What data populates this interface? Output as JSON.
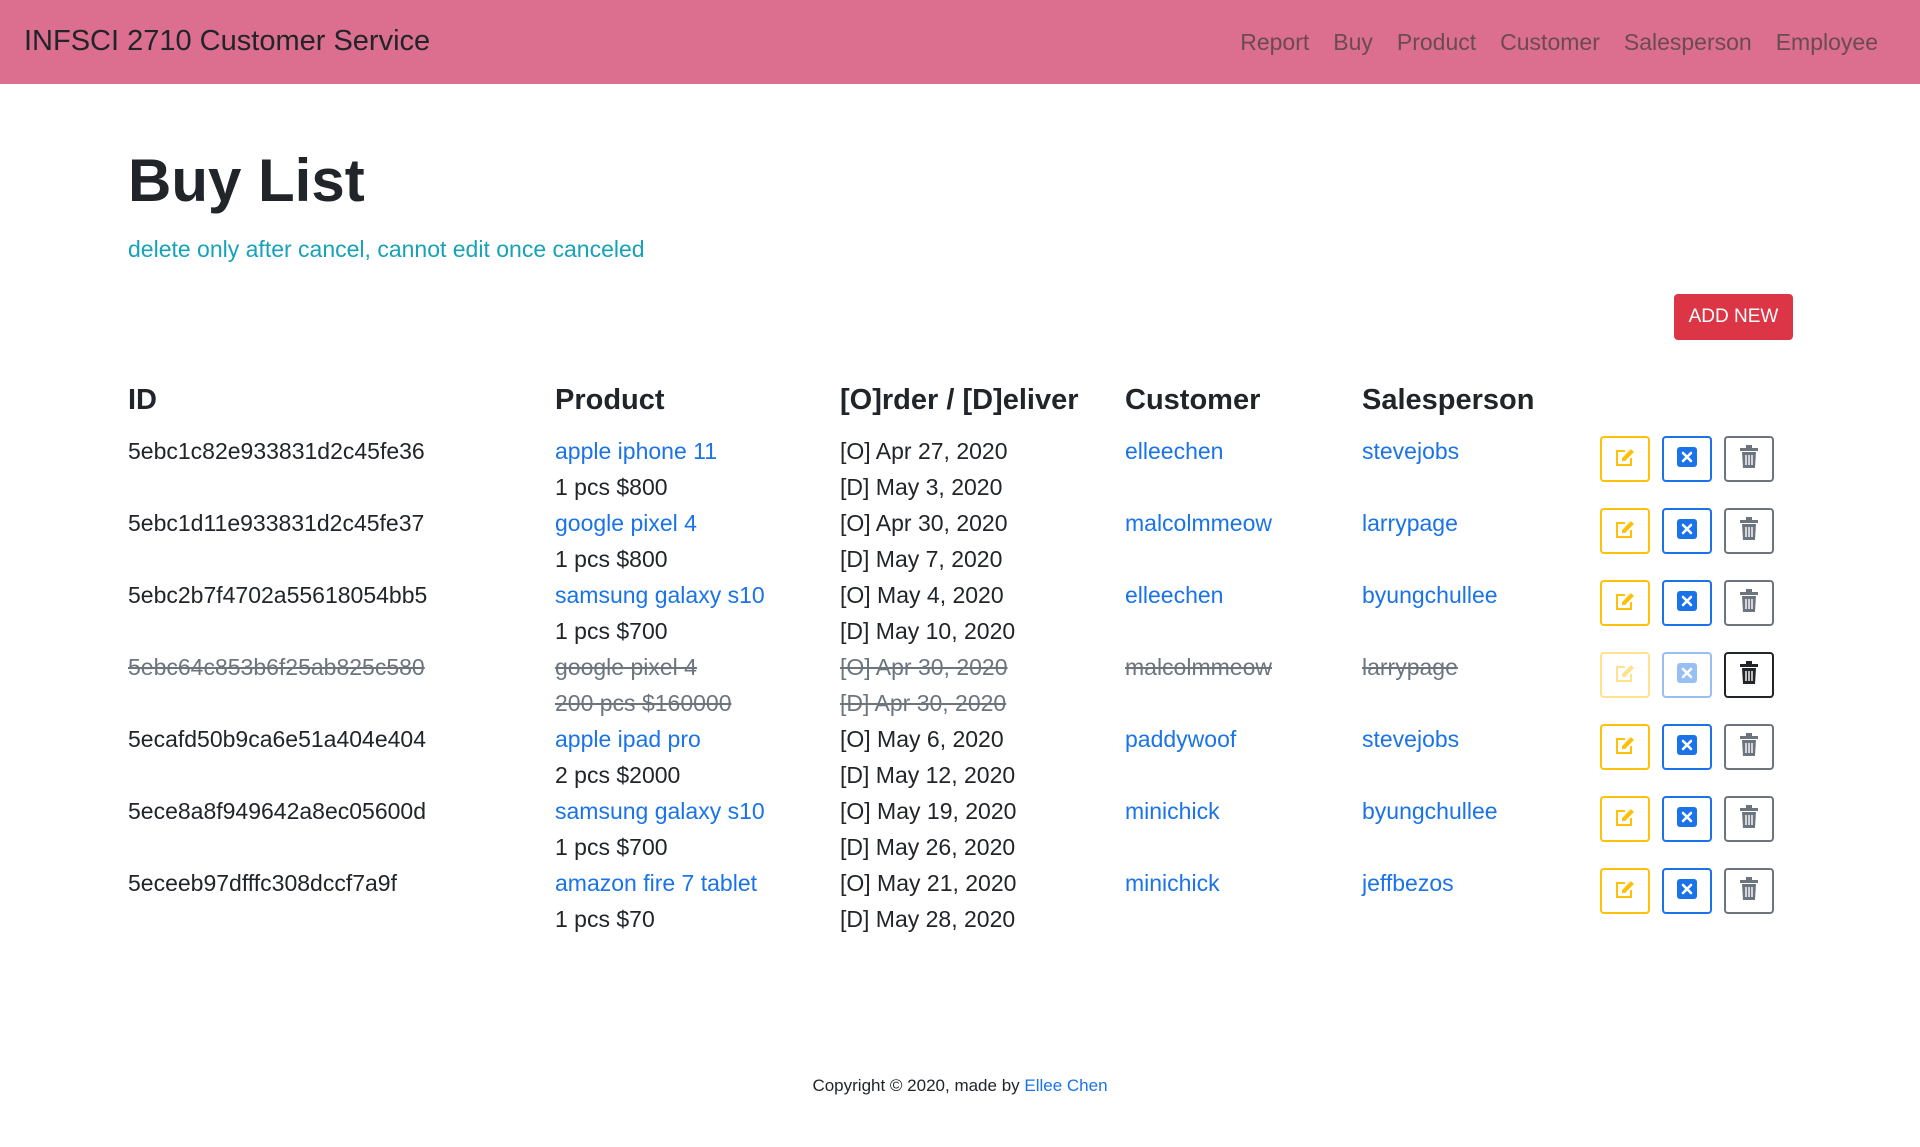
{
  "navbar": {
    "brand": "INFSCI 2710 Customer Service",
    "links": [
      "Report",
      "Buy",
      "Product",
      "Customer",
      "Salesperson",
      "Employee"
    ]
  },
  "page": {
    "title": "Buy List",
    "note": "delete only after cancel, cannot edit once canceled",
    "add_label": "ADD NEW"
  },
  "table": {
    "headers": [
      "ID",
      "Product",
      "[O]rder / [D]eliver",
      "Customer",
      "Salesperson"
    ],
    "rows": [
      {
        "id": "5ebc1c82e933831d2c45fe36",
        "product": "apple iphone 11",
        "qty_price": "1 pcs $800",
        "order": "[O] Apr 27, 2020",
        "deliver": "[D] May 3, 2020",
        "customer": "elleechen",
        "salesperson": "stevejobs",
        "canceled": false
      },
      {
        "id": "5ebc1d11e933831d2c45fe37",
        "product": "google pixel 4",
        "qty_price": "1 pcs $800",
        "order": "[O] Apr 30, 2020",
        "deliver": "[D] May 7, 2020",
        "customer": "malcolmmeow",
        "salesperson": "larrypage",
        "canceled": false
      },
      {
        "id": "5ebc2b7f4702a55618054bb5",
        "product": "samsung galaxy s10",
        "qty_price": "1 pcs $700",
        "order": "[O] May 4, 2020",
        "deliver": "[D] May 10, 2020",
        "customer": "elleechen",
        "salesperson": "byungchullee",
        "canceled": false
      },
      {
        "id": "5ebc64c853b6f25ab825c580",
        "product": "google pixel 4",
        "qty_price": "200 pcs $160000",
        "order": "[O] Apr 30, 2020",
        "deliver": "[D] Apr 30, 2020",
        "customer": "malcolmmeow",
        "salesperson": "larrypage",
        "canceled": true
      },
      {
        "id": "5ecafd50b9ca6e51a404e404",
        "product": "apple ipad pro",
        "qty_price": "2 pcs $2000",
        "order": "[O] May 6, 2020",
        "deliver": "[D] May 12, 2020",
        "customer": "paddywoof",
        "salesperson": "stevejobs",
        "canceled": false
      },
      {
        "id": "5ece8a8f949642a8ec05600d",
        "product": "samsung galaxy s10",
        "qty_price": "1 pcs $700",
        "order": "[O] May 19, 2020",
        "deliver": "[D] May 26, 2020",
        "customer": "minichick",
        "salesperson": "byungchullee",
        "canceled": false
      },
      {
        "id": "5eceeb97dfffc308dccf7a9f",
        "product": "amazon fire 7 tablet",
        "qty_price": "1 pcs $70",
        "order": "[O] May 21, 2020",
        "deliver": "[D] May 28, 2020",
        "customer": "minichick",
        "salesperson": "jeffbezos",
        "canceled": false
      }
    ]
  },
  "footer": {
    "prefix": "Copyright © 2020, made by ",
    "author": "Ellee Chen"
  },
  "icons": {
    "edit": "edit-icon",
    "cancel": "x-square-icon",
    "delete": "trash-icon"
  },
  "colors": {
    "navbar": "#dc6e8f",
    "link": "#1a73e8",
    "note": "#17a2b8",
    "add_button": "#dc3545",
    "edit": "#ffc107",
    "cancel": "#1a73e8",
    "delete": "#6c757d"
  }
}
